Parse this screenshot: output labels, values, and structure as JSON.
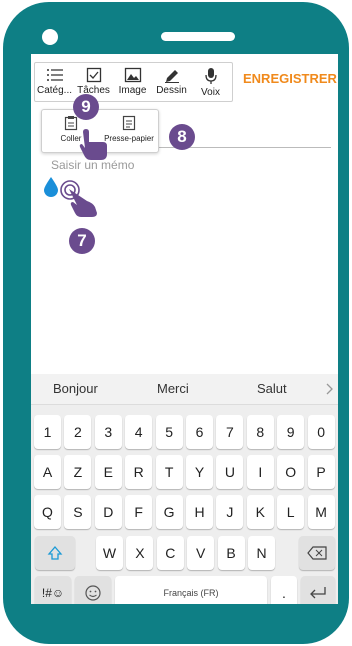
{
  "toolbar": {
    "items": [
      {
        "label": "Catég...",
        "icon": "list-icon"
      },
      {
        "label": "Tâches",
        "icon": "checkbox-icon"
      },
      {
        "label": "Image",
        "icon": "image-icon"
      },
      {
        "label": "Dessin",
        "icon": "pen-icon"
      },
      {
        "label": "Voix",
        "icon": "microphone-icon"
      }
    ],
    "save_label": "ENREGISTRER"
  },
  "paste_menu": {
    "items": [
      {
        "label": "Coller",
        "icon": "paste-icon"
      },
      {
        "label": "Presse-papier",
        "icon": "clipboard-icon"
      }
    ]
  },
  "memo": {
    "placeholder": "Saisir un mémo"
  },
  "annotations": {
    "step_9": "9",
    "step_8": "8",
    "step_7": "7"
  },
  "keyboard": {
    "suggestions": [
      "Bonjour",
      "Merci",
      "Salut"
    ],
    "row1": [
      "1",
      "2",
      "3",
      "4",
      "5",
      "6",
      "7",
      "8",
      "9",
      "0"
    ],
    "row2": [
      "A",
      "Z",
      "E",
      "R",
      "T",
      "Y",
      "U",
      "I",
      "O",
      "P"
    ],
    "row3": [
      "Q",
      "S",
      "D",
      "F",
      "G",
      "H",
      "J",
      "K",
      "L",
      "M"
    ],
    "row4": [
      "W",
      "X",
      "C",
      "V",
      "B",
      "N"
    ],
    "symbols_label": "!#☺",
    "space_label": "Français (FR)",
    "period_label": "."
  },
  "colors": {
    "frame": "#0e7f85",
    "accent": "#f08a1c",
    "badge": "#6a4b8e",
    "drop": "#1a8fd9"
  }
}
